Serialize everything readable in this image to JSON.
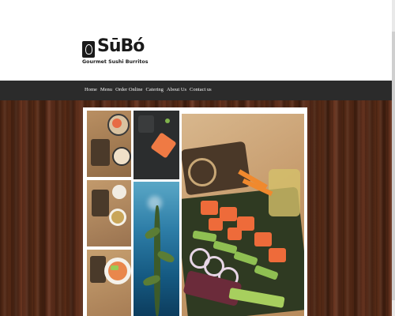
{
  "brand": {
    "logo_word": "SūBó",
    "tagline": "Gourmet Sushi Burritos"
  },
  "nav": {
    "items": [
      "Home",
      "Menu",
      "Order Online",
      "Catering",
      "About Us",
      "Contact us"
    ]
  },
  "gallery": {
    "icons": [
      "sushi-bowls-photo",
      "salmon-fillet-photo",
      "miso-soup-photo",
      "kelp-forest-photo",
      "poke-bowl-photo",
      "sushi-burrito-prep-photo"
    ]
  }
}
